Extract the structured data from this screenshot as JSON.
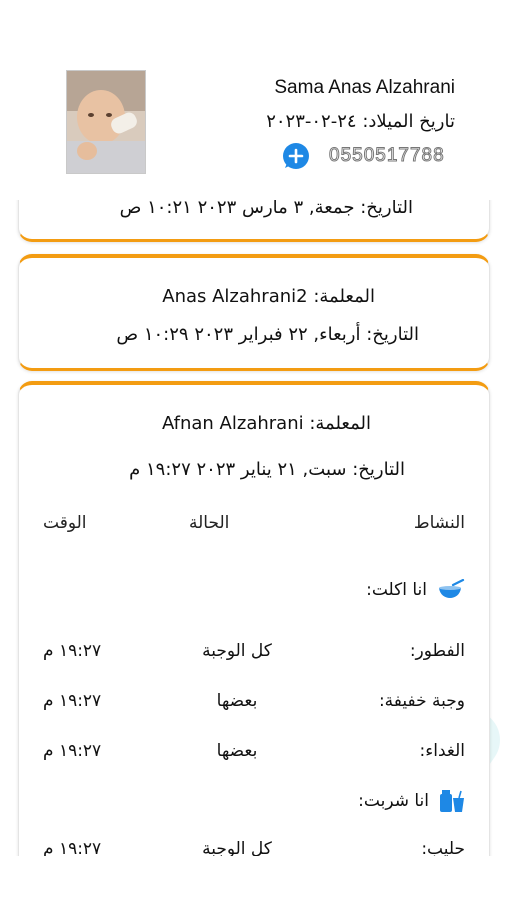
{
  "profile": {
    "name": "Sama Anas Alzahrani",
    "birth_label": "تاريخ الميلاد:",
    "birth_value": "٢٤-٠٢-٢٠٢٣",
    "phone": "0550517788"
  },
  "cards": [
    {
      "date_label": "التاريخ:",
      "date_value": "جمعة, ٣ مارس ٢٠٢٣ ١٠:٢١ ص"
    },
    {
      "teacher_label": "المعلمة:",
      "teacher_name": "Anas Alzahrani2",
      "date_label": "التاريخ:",
      "date_value": "أربعاء, ٢٢ فبراير ٢٠٢٣ ١٠:٢٩ ص"
    },
    {
      "teacher_label": "المعلمة:",
      "teacher_name": "Afnan Alzahrani",
      "date_label": "التاريخ:",
      "date_value": "سبت, ٢١ يناير ٢٠٢٣ ١٩:٢٧ م",
      "headers": {
        "activity": "النشاط",
        "status": "الحالة",
        "time": "الوقت"
      },
      "sections": [
        {
          "title": "انا اكلت:",
          "icon": "bowl-icon",
          "rows": [
            {
              "label": "الفطور:",
              "status": "كل الوجبة",
              "time": "١٩:٢٧ م"
            },
            {
              "label": "وجبة خفيفة:",
              "status": "بعضها",
              "time": "١٩:٢٧ م"
            },
            {
              "label": "الغداء:",
              "status": "بعضها",
              "time": "١٩:٢٧ م"
            }
          ]
        },
        {
          "title": "انا شربت:",
          "icon": "drink-icon",
          "rows": [
            {
              "label": "حليب:",
              "status": "كل الوجبة",
              "time": "١٩:٢٧ م"
            }
          ]
        }
      ]
    }
  ],
  "colors": {
    "accent": "#f39c12",
    "button": "#1e88e5",
    "icon": "#1e88e5",
    "watermark": "#3dbfc4"
  }
}
